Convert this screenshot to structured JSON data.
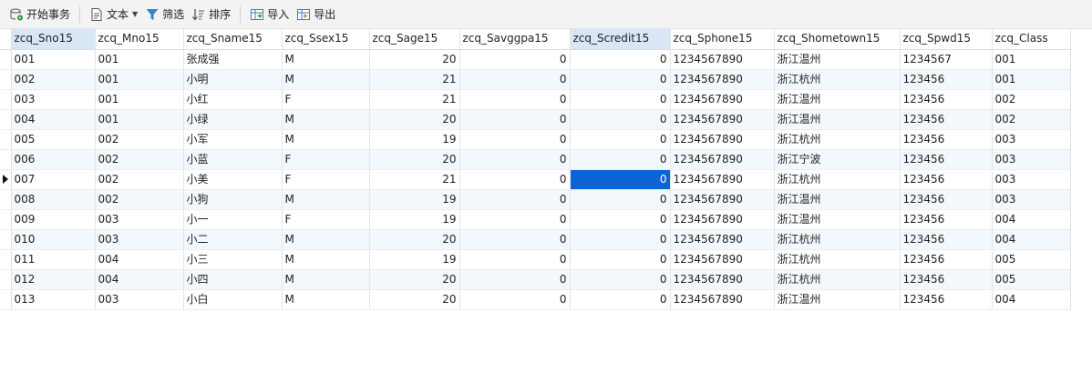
{
  "toolbar": {
    "begin_transaction": "开始事务",
    "text": "文本",
    "filter": "筛选",
    "sort": "排序",
    "import": "导入",
    "export": "导出"
  },
  "colors": {
    "selected_cell": "#0a64d3",
    "selected_header": "#d8e6f5",
    "alt_row": "#f3f8fd"
  },
  "table": {
    "columns": [
      "zcq_Sno15",
      "zcq_Mno15",
      "zcq_Sname15",
      "zcq_Ssex15",
      "zcq_Sage15",
      "zcq_Savggpa15",
      "zcq_Scredit15",
      "zcq_Sphone15",
      "zcq_Shometown15",
      "zcq_Spwd15",
      "zcq_Class"
    ],
    "rows": [
      [
        "001",
        "001",
        "张成强",
        "M",
        "20",
        "0",
        "0",
        "1234567890",
        "浙江温州",
        "1234567",
        "001"
      ],
      [
        "002",
        "001",
        "小明",
        "M",
        "21",
        "0",
        "0",
        "1234567890",
        "浙江杭州",
        "123456",
        "001"
      ],
      [
        "003",
        "001",
        "小红",
        "F",
        "21",
        "0",
        "0",
        "1234567890",
        "浙江温州",
        "123456",
        "002"
      ],
      [
        "004",
        "001",
        "小绿",
        "M",
        "20",
        "0",
        "0",
        "1234567890",
        "浙江温州",
        "123456",
        "002"
      ],
      [
        "005",
        "002",
        "小军",
        "M",
        "19",
        "0",
        "0",
        "1234567890",
        "浙江杭州",
        "123456",
        "003"
      ],
      [
        "006",
        "002",
        "小蓝",
        "F",
        "20",
        "0",
        "0",
        "1234567890",
        "浙江宁波",
        "123456",
        "003"
      ],
      [
        "007",
        "002",
        "小美",
        "F",
        "21",
        "0",
        "0",
        "1234567890",
        "浙江杭州",
        "123456",
        "003"
      ],
      [
        "008",
        "002",
        "小狗",
        "M",
        "19",
        "0",
        "0",
        "1234567890",
        "浙江温州",
        "123456",
        "003"
      ],
      [
        "009",
        "003",
        "小一",
        "F",
        "19",
        "0",
        "0",
        "1234567890",
        "浙江温州",
        "123456",
        "004"
      ],
      [
        "010",
        "003",
        "小二",
        "M",
        "20",
        "0",
        "0",
        "1234567890",
        "浙江杭州",
        "123456",
        "004"
      ],
      [
        "011",
        "004",
        "小三",
        "M",
        "19",
        "0",
        "0",
        "1234567890",
        "浙江杭州",
        "123456",
        "005"
      ],
      [
        "012",
        "004",
        "小四",
        "M",
        "20",
        "0",
        "0",
        "1234567890",
        "浙江杭州",
        "123456",
        "005"
      ],
      [
        "013",
        "003",
        "小白",
        "M",
        "20",
        "0",
        "0",
        "1234567890",
        "浙江温州",
        "123456",
        "004"
      ]
    ]
  }
}
